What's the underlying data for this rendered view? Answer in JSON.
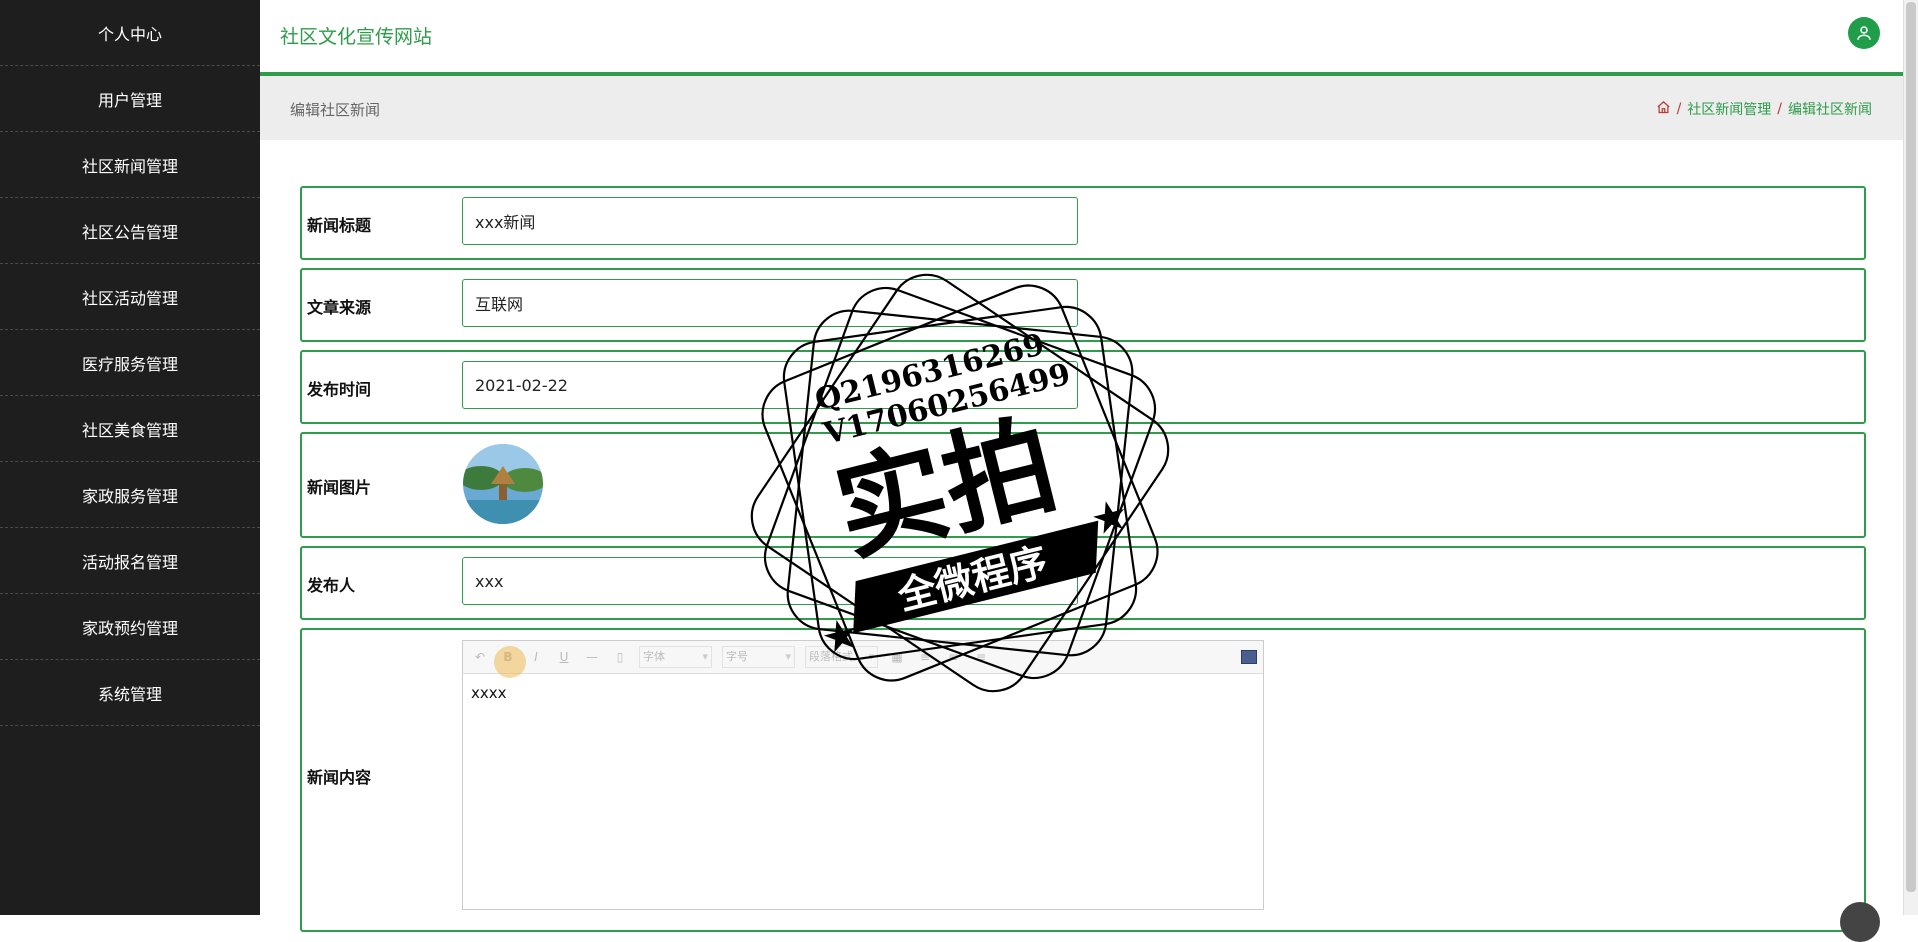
{
  "sidebar": {
    "items": [
      {
        "label": "个人中心"
      },
      {
        "label": "用户管理"
      },
      {
        "label": "社区新闻管理"
      },
      {
        "label": "社区公告管理"
      },
      {
        "label": "社区活动管理"
      },
      {
        "label": "医疗服务管理"
      },
      {
        "label": "社区美食管理"
      },
      {
        "label": "家政服务管理"
      },
      {
        "label": "活动报名管理"
      },
      {
        "label": "家政预约管理"
      },
      {
        "label": "系统管理"
      }
    ]
  },
  "header": {
    "site_title": "社区文化宣传网站",
    "avatar_icon": "user-icon",
    "accent_color": "#2e9c4a"
  },
  "page": {
    "title": "编辑社区新闻",
    "breadcrumb": [
      {
        "icon": "home-icon"
      },
      {
        "label": "社区新闻管理"
      },
      {
        "label": "编辑社区新闻"
      }
    ]
  },
  "form": {
    "title_label": "新闻标题",
    "title_value": "xxx新闻",
    "source_label": "文章来源",
    "source_value": "互联网",
    "date_label": "发布时间",
    "date_value": "2021-02-22",
    "image_label": "新闻图片",
    "publisher_label": "发布人",
    "publisher_value": "xxx",
    "content_label": "新闻内容",
    "content_value": "xxxx",
    "editor_toolbar": {
      "font_family": "字体",
      "font_size": "字号",
      "paragraph": "段落格式"
    }
  },
  "watermark": {
    "line1": "Q2196316269",
    "line2": "V17060256499",
    "main": "实拍",
    "banner": "全微程序"
  }
}
